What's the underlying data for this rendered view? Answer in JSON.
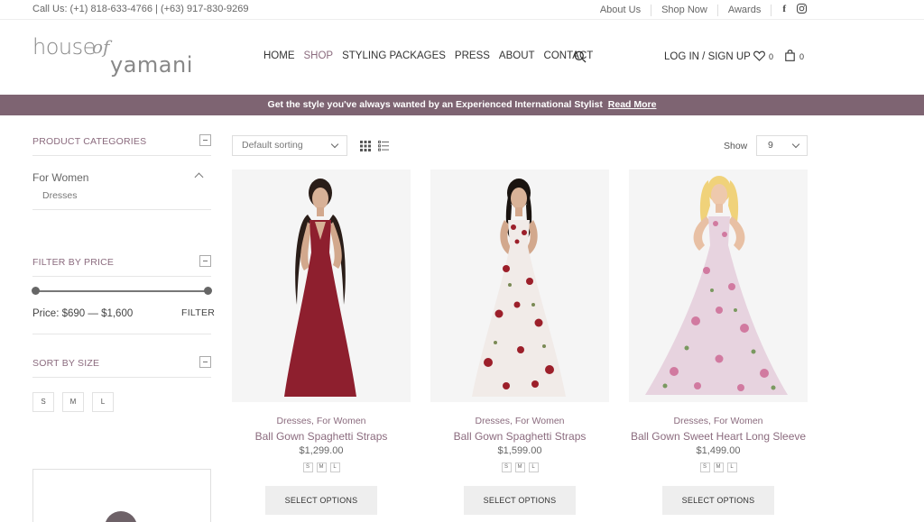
{
  "topbar": {
    "call": "Call Us:  (+1) 818-633-4766 | (+63) 917-830-9269",
    "links": [
      "About Us",
      "Shop Now",
      "Awards"
    ],
    "social": [
      "facebook-icon",
      "instagram-icon"
    ]
  },
  "logo": {
    "w1": "house",
    "w2": "of",
    "w3": "yamani"
  },
  "nav": {
    "items": [
      "HOME",
      "SHOP",
      "STYLING PACKAGES",
      "PRESS",
      "ABOUT",
      "CONTACT"
    ],
    "active": "SHOP",
    "account": "LOG IN / SIGN UP",
    "wishlist_count": "0",
    "cart_count": "0"
  },
  "promo": {
    "text": "Get the style you've always wanted by an Experienced International Stylist",
    "link": "Read More"
  },
  "sidebar": {
    "categories_title": "PRODUCT CATEGORIES",
    "category": "For Women",
    "subcategory": "Dresses",
    "price_title": "FILTER BY PRICE",
    "price_label": "Price: $690 — $1,600",
    "filter_label": "FILTER",
    "size_title": "SORT BY SIZE",
    "sizes": [
      "S",
      "M",
      "L"
    ]
  },
  "toolbar": {
    "sort": "Default sorting",
    "show_label": "Show",
    "show_value": "9"
  },
  "products": [
    {
      "cats": "Dresses, For Women",
      "name": "Ball Gown Spaghetti Straps",
      "price": "$1,299.00",
      "sizes": [
        "S",
        "M",
        "L"
      ],
      "button": "SELECT OPTIONS",
      "dress_color": "#8e1f2e",
      "hair_color": "#2a1d18"
    },
    {
      "cats": "Dresses, For Women",
      "name": "Ball Gown Spaghetti Straps",
      "price": "$1,599.00",
      "sizes": [
        "S",
        "M",
        "L"
      ],
      "button": "SELECT OPTIONS",
      "dress_color": "#f1ebe8",
      "hair_color": "#1a1410"
    },
    {
      "cats": "Dresses, For Women",
      "name": "Ball Gown Sweet Heart Long Sleeve",
      "price": "$1,499.00",
      "sizes": [
        "S",
        "M",
        "L"
      ],
      "button": "SELECT OPTIONS",
      "dress_color": "#e7d3df",
      "hair_color": "#f0d27a"
    }
  ],
  "colors": {
    "accent": "#8b6b7e",
    "promo_bg": "#7e6472"
  }
}
